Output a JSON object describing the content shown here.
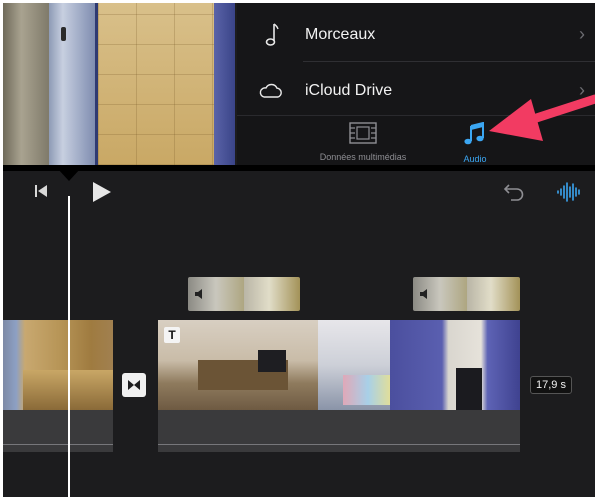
{
  "library": {
    "items": [
      {
        "label": "Morceaux",
        "icon": "music-note-icon"
      },
      {
        "label": "iCloud Drive",
        "icon": "cloud-icon"
      }
    ],
    "tabs": [
      {
        "label": "Données multimédias",
        "icon": "film-strip-icon",
        "active": false
      },
      {
        "label": "Audio",
        "icon": "music-notes-icon",
        "active": true
      }
    ]
  },
  "controls": {
    "skip_back_icon": "skip-to-start-icon",
    "play_icon": "play-icon",
    "undo_icon": "undo-icon",
    "audio_wave_icon": "audio-waveform-icon"
  },
  "timeline": {
    "duration_label": "17,9 s",
    "title_badge": "T"
  },
  "colors": {
    "accent": "#3ba6f2",
    "annotation_arrow": "#f23b62",
    "background": "#1c1c1e"
  }
}
